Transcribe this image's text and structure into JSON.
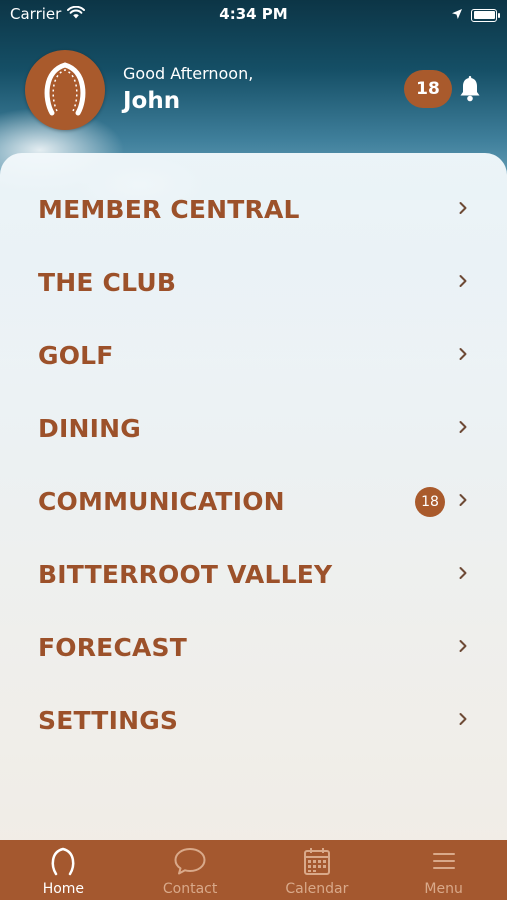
{
  "status_bar": {
    "carrier": "Carrier",
    "time": "4:34 PM"
  },
  "header": {
    "greeting": "Good Afternoon,",
    "user_name": "John",
    "notification_count": "18"
  },
  "menu": {
    "items": [
      {
        "label": "MEMBER CENTRAL",
        "badge": ""
      },
      {
        "label": "THE CLUB",
        "badge": ""
      },
      {
        "label": "GOLF",
        "badge": ""
      },
      {
        "label": "DINING",
        "badge": ""
      },
      {
        "label": "COMMUNICATION",
        "badge": "18"
      },
      {
        "label": "BITTERROOT VALLEY",
        "badge": ""
      },
      {
        "label": "FORECAST",
        "badge": ""
      },
      {
        "label": "SETTINGS",
        "badge": ""
      }
    ]
  },
  "tab_bar": {
    "tabs": [
      {
        "label": "Home",
        "icon": "horseshoe-icon",
        "active": true
      },
      {
        "label": "Contact",
        "icon": "chat-bubble-icon",
        "active": false
      },
      {
        "label": "Calendar",
        "icon": "calendar-icon",
        "active": false
      },
      {
        "label": "Menu",
        "icon": "hamburger-icon",
        "active": false
      }
    ]
  },
  "colors": {
    "accent": "#a95a2c",
    "menu_text": "#9c512a",
    "tab_bar": "#a4582f",
    "tab_inactive": "#d9a98a"
  }
}
